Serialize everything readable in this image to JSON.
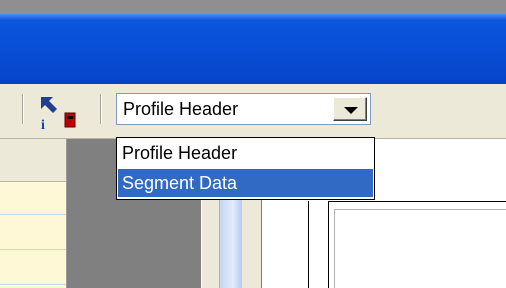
{
  "toolbar": {
    "profile_select": {
      "value": "Profile Header",
      "options": [
        "Profile Header",
        "Segment Data"
      ],
      "highlighted_option": "Segment Data"
    },
    "info_icon": "info-cursor-icon"
  },
  "colors": {
    "title_bar": "#0a50d8",
    "selection": "#316ac5",
    "workspace": "#808080"
  }
}
